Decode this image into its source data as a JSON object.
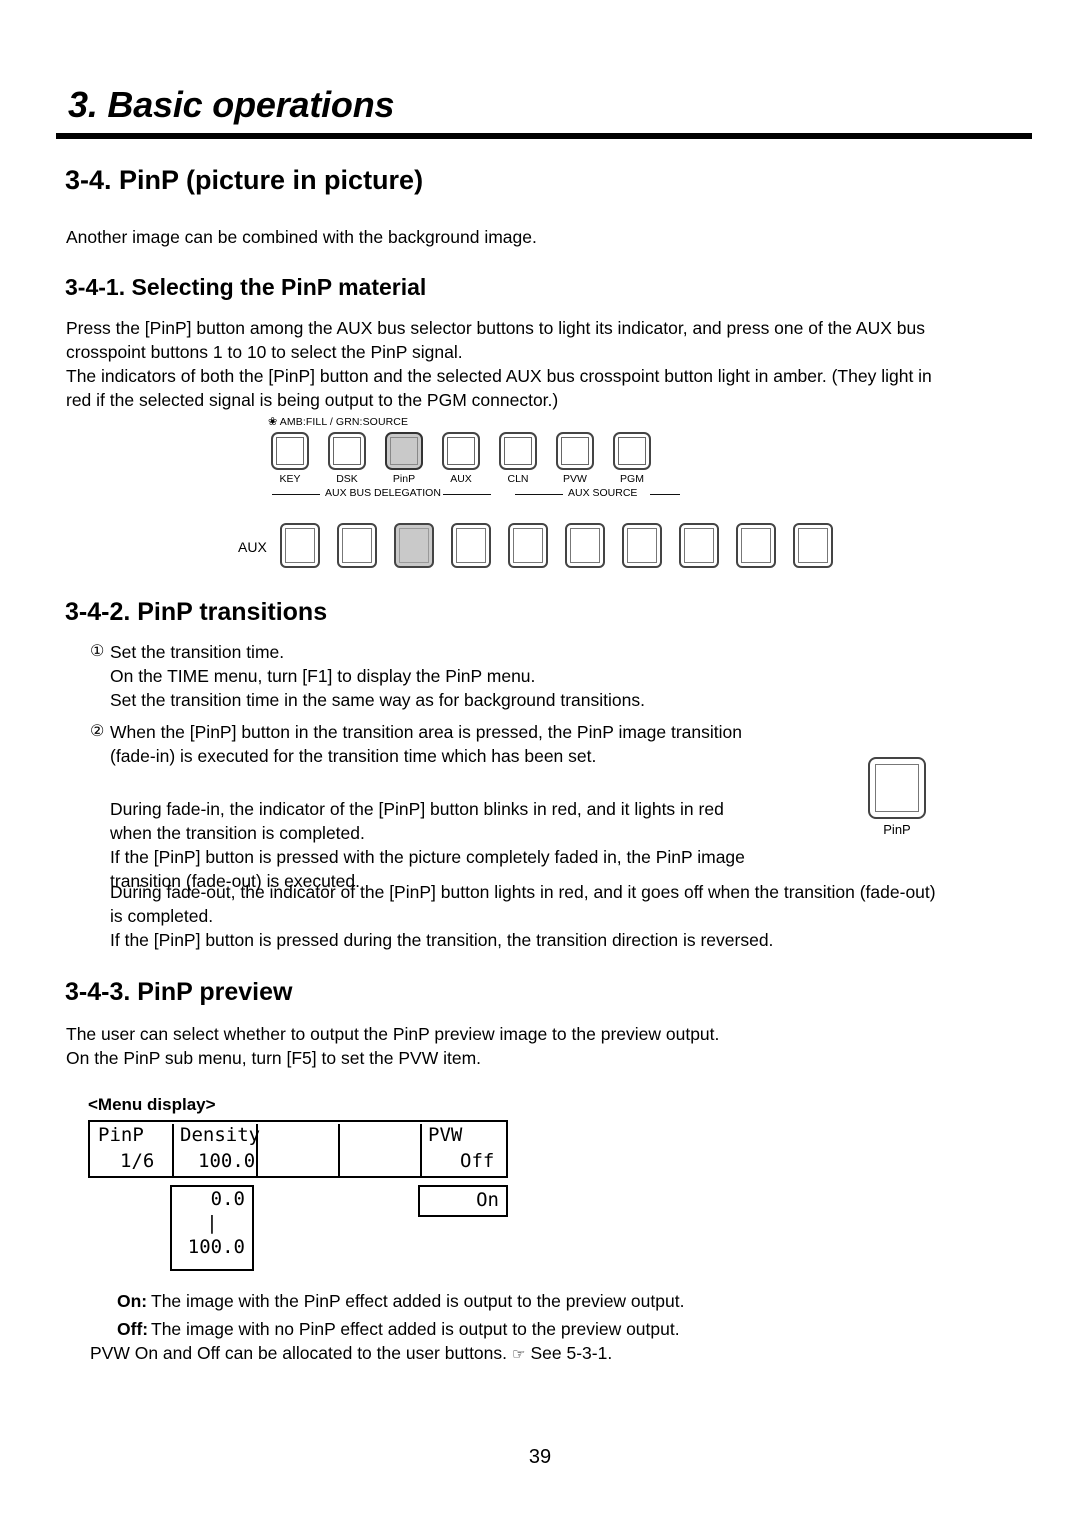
{
  "chapter": {
    "title": "3. Basic operations"
  },
  "section": {
    "heading": "3-4. PinP (picture in picture)",
    "intro": "Another image can be combined with the background image."
  },
  "subsection_1": {
    "heading": "3-4-1. Selecting the PinP material",
    "para1_line1": "Press the [PinP] button among the AUX bus selector buttons to light its indicator, and press one of the AUX bus",
    "para1_line2": "crosspoint buttons 1 to 10 to select the PinP signal.",
    "para2_line1": "The indicators of both the [PinP] button and the selected AUX bus crosspoint button light in amber. (They light in",
    "para2_line2": "red if the selected signal is being output to the PGM connector.)"
  },
  "panel": {
    "amb_label": "AMB:FILL / GRN:SOURCE",
    "star_icon": "flower-icon",
    "selector_buttons": [
      {
        "caption": "KEY",
        "lit": false
      },
      {
        "caption": "DSK",
        "lit": false
      },
      {
        "caption": "PinP",
        "lit": true
      },
      {
        "caption": "AUX",
        "lit": false
      },
      {
        "caption": "CLN",
        "lit": false
      },
      {
        "caption": "PVW",
        "lit": false
      },
      {
        "caption": "PGM",
        "lit": false
      }
    ],
    "group_delegation": "AUX BUS DELEGATION",
    "group_source": "AUX SOURCE",
    "aux_row_label": "AUX",
    "aux_buttons": [
      {
        "lit": false
      },
      {
        "lit": false
      },
      {
        "lit": true
      },
      {
        "lit": false
      },
      {
        "lit": false
      },
      {
        "lit": false
      },
      {
        "lit": false
      },
      {
        "lit": false
      },
      {
        "lit": false
      },
      {
        "lit": false
      }
    ]
  },
  "subsection_2": {
    "heading": "3-4-2. PinP transitions",
    "item1_marker": "①",
    "item1_line1": "Set the transition time.",
    "item1_line2": "On the TIME menu, turn [F1] to display the PinP menu.",
    "item1_line3": "Set the transition time in the same way as for background transitions.",
    "item2_marker": "②",
    "item2_line1": "When the [PinP] button in the transition area is pressed, the PinP image transition",
    "item2_line2": "(fade-in) is executed for the transition time which has been set.",
    "item2_para2_line1": "During fade-in, the indicator of the [PinP] button blinks in red, and it lights in red",
    "item2_para2_line2": "when the transition is completed.",
    "item2_para2_line3": "If the [PinP] button is pressed with the picture completely faded in, the PinP image",
    "item2_para2_line4": "transition (fade-out) is executed.",
    "item2_para3_line1": "During fade-out, the indicator of the [PinP] button lights in red, and it goes off when the transition (fade-out)",
    "item2_para3_line2": "is completed.",
    "item2_para3_line3": "If the [PinP] button is pressed during the transition, the transition direction is reversed.",
    "side_button_caption": "PinP"
  },
  "subsection_3": {
    "heading": "3-4-3. PinP preview",
    "para_line1": "The user can select whether to output the PinP preview image to the preview output.",
    "para_line2": "On the PinP sub menu, turn [F5] to set the PVW item.",
    "menu_display_label": "<Menu display>"
  },
  "menu_display": {
    "col1_top": "PinP",
    "col1_bottom": "1/6",
    "col2_top": "Density",
    "col2_bottom": "100.0",
    "col3_top": "",
    "col3_bottom": "",
    "col4_top": "",
    "col4_bottom": "",
    "col5_top": "PVW",
    "col5_bottom": "Off",
    "sub_density_max": "0.0",
    "sub_density_bar": "|",
    "sub_density_min": "100.0",
    "sub_pvw_option": "On"
  },
  "definitions": {
    "on_term": "On:",
    "on_desc": "The image with the PinP effect added is output to the preview output.",
    "off_term": "Off:",
    "off_desc": "The image with no PinP effect added is output to the preview output.",
    "footer_pre": "PVW On and Off can be allocated to the user buttons.",
    "footer_hand_icon": "pointing-hand-icon",
    "footer_post": "See 5-3-1."
  },
  "footer": {
    "page_number": "39"
  }
}
